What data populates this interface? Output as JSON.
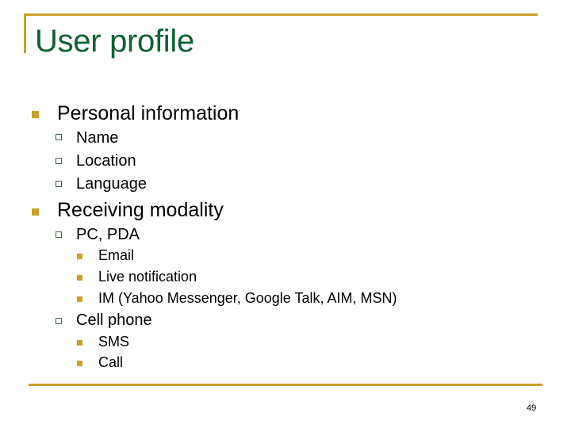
{
  "slide": {
    "title": "User profile",
    "page_number": "49",
    "accent_color": "#c8a02a",
    "title_color": "#0e6132",
    "sections": [
      {
        "label": "Personal information",
        "items": [
          {
            "label": "Name"
          },
          {
            "label": "Location"
          },
          {
            "label": "Language"
          }
        ]
      },
      {
        "label": "Receiving modality",
        "items": [
          {
            "label": "PC, PDA",
            "items": [
              "Email",
              "Live notification",
              "IM (Yahoo Messenger, Google Talk, AIM, MSN)"
            ]
          },
          {
            "label": "Cell phone",
            "items": [
              "SMS",
              "Call"
            ]
          }
        ]
      }
    ]
  }
}
